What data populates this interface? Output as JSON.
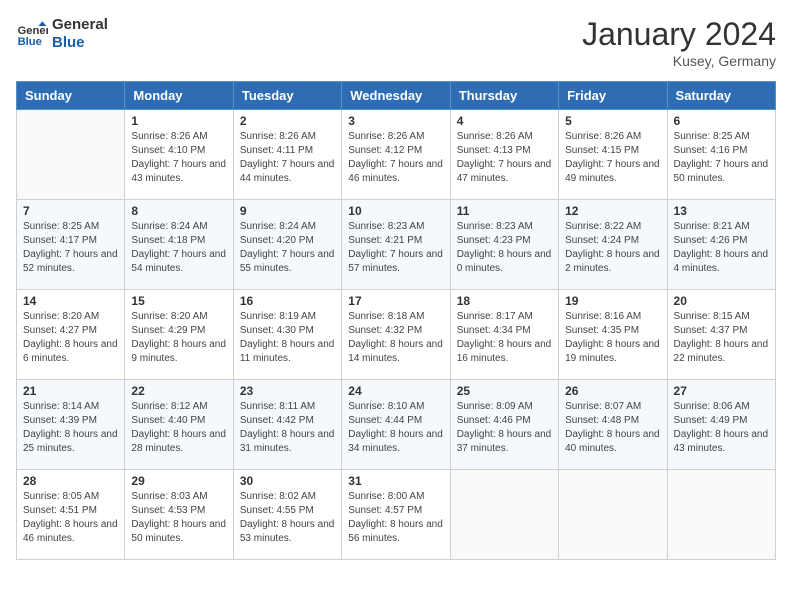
{
  "header": {
    "logo_line1": "General",
    "logo_line2": "Blue",
    "month_title": "January 2024",
    "location": "Kusey, Germany"
  },
  "days_of_week": [
    "Sunday",
    "Monday",
    "Tuesday",
    "Wednesday",
    "Thursday",
    "Friday",
    "Saturday"
  ],
  "weeks": [
    [
      {
        "day": "",
        "sunrise": "",
        "sunset": "",
        "daylight": ""
      },
      {
        "day": "1",
        "sunrise": "Sunrise: 8:26 AM",
        "sunset": "Sunset: 4:10 PM",
        "daylight": "Daylight: 7 hours and 43 minutes."
      },
      {
        "day": "2",
        "sunrise": "Sunrise: 8:26 AM",
        "sunset": "Sunset: 4:11 PM",
        "daylight": "Daylight: 7 hours and 44 minutes."
      },
      {
        "day": "3",
        "sunrise": "Sunrise: 8:26 AM",
        "sunset": "Sunset: 4:12 PM",
        "daylight": "Daylight: 7 hours and 46 minutes."
      },
      {
        "day": "4",
        "sunrise": "Sunrise: 8:26 AM",
        "sunset": "Sunset: 4:13 PM",
        "daylight": "Daylight: 7 hours and 47 minutes."
      },
      {
        "day": "5",
        "sunrise": "Sunrise: 8:26 AM",
        "sunset": "Sunset: 4:15 PM",
        "daylight": "Daylight: 7 hours and 49 minutes."
      },
      {
        "day": "6",
        "sunrise": "Sunrise: 8:25 AM",
        "sunset": "Sunset: 4:16 PM",
        "daylight": "Daylight: 7 hours and 50 minutes."
      }
    ],
    [
      {
        "day": "7",
        "sunrise": "Sunrise: 8:25 AM",
        "sunset": "Sunset: 4:17 PM",
        "daylight": "Daylight: 7 hours and 52 minutes."
      },
      {
        "day": "8",
        "sunrise": "Sunrise: 8:24 AM",
        "sunset": "Sunset: 4:18 PM",
        "daylight": "Daylight: 7 hours and 54 minutes."
      },
      {
        "day": "9",
        "sunrise": "Sunrise: 8:24 AM",
        "sunset": "Sunset: 4:20 PM",
        "daylight": "Daylight: 7 hours and 55 minutes."
      },
      {
        "day": "10",
        "sunrise": "Sunrise: 8:23 AM",
        "sunset": "Sunset: 4:21 PM",
        "daylight": "Daylight: 7 hours and 57 minutes."
      },
      {
        "day": "11",
        "sunrise": "Sunrise: 8:23 AM",
        "sunset": "Sunset: 4:23 PM",
        "daylight": "Daylight: 8 hours and 0 minutes."
      },
      {
        "day": "12",
        "sunrise": "Sunrise: 8:22 AM",
        "sunset": "Sunset: 4:24 PM",
        "daylight": "Daylight: 8 hours and 2 minutes."
      },
      {
        "day": "13",
        "sunrise": "Sunrise: 8:21 AM",
        "sunset": "Sunset: 4:26 PM",
        "daylight": "Daylight: 8 hours and 4 minutes."
      }
    ],
    [
      {
        "day": "14",
        "sunrise": "Sunrise: 8:20 AM",
        "sunset": "Sunset: 4:27 PM",
        "daylight": "Daylight: 8 hours and 6 minutes."
      },
      {
        "day": "15",
        "sunrise": "Sunrise: 8:20 AM",
        "sunset": "Sunset: 4:29 PM",
        "daylight": "Daylight: 8 hours and 9 minutes."
      },
      {
        "day": "16",
        "sunrise": "Sunrise: 8:19 AM",
        "sunset": "Sunset: 4:30 PM",
        "daylight": "Daylight: 8 hours and 11 minutes."
      },
      {
        "day": "17",
        "sunrise": "Sunrise: 8:18 AM",
        "sunset": "Sunset: 4:32 PM",
        "daylight": "Daylight: 8 hours and 14 minutes."
      },
      {
        "day": "18",
        "sunrise": "Sunrise: 8:17 AM",
        "sunset": "Sunset: 4:34 PM",
        "daylight": "Daylight: 8 hours and 16 minutes."
      },
      {
        "day": "19",
        "sunrise": "Sunrise: 8:16 AM",
        "sunset": "Sunset: 4:35 PM",
        "daylight": "Daylight: 8 hours and 19 minutes."
      },
      {
        "day": "20",
        "sunrise": "Sunrise: 8:15 AM",
        "sunset": "Sunset: 4:37 PM",
        "daylight": "Daylight: 8 hours and 22 minutes."
      }
    ],
    [
      {
        "day": "21",
        "sunrise": "Sunrise: 8:14 AM",
        "sunset": "Sunset: 4:39 PM",
        "daylight": "Daylight: 8 hours and 25 minutes."
      },
      {
        "day": "22",
        "sunrise": "Sunrise: 8:12 AM",
        "sunset": "Sunset: 4:40 PM",
        "daylight": "Daylight: 8 hours and 28 minutes."
      },
      {
        "day": "23",
        "sunrise": "Sunrise: 8:11 AM",
        "sunset": "Sunset: 4:42 PM",
        "daylight": "Daylight: 8 hours and 31 minutes."
      },
      {
        "day": "24",
        "sunrise": "Sunrise: 8:10 AM",
        "sunset": "Sunset: 4:44 PM",
        "daylight": "Daylight: 8 hours and 34 minutes."
      },
      {
        "day": "25",
        "sunrise": "Sunrise: 8:09 AM",
        "sunset": "Sunset: 4:46 PM",
        "daylight": "Daylight: 8 hours and 37 minutes."
      },
      {
        "day": "26",
        "sunrise": "Sunrise: 8:07 AM",
        "sunset": "Sunset: 4:48 PM",
        "daylight": "Daylight: 8 hours and 40 minutes."
      },
      {
        "day": "27",
        "sunrise": "Sunrise: 8:06 AM",
        "sunset": "Sunset: 4:49 PM",
        "daylight": "Daylight: 8 hours and 43 minutes."
      }
    ],
    [
      {
        "day": "28",
        "sunrise": "Sunrise: 8:05 AM",
        "sunset": "Sunset: 4:51 PM",
        "daylight": "Daylight: 8 hours and 46 minutes."
      },
      {
        "day": "29",
        "sunrise": "Sunrise: 8:03 AM",
        "sunset": "Sunset: 4:53 PM",
        "daylight": "Daylight: 8 hours and 50 minutes."
      },
      {
        "day": "30",
        "sunrise": "Sunrise: 8:02 AM",
        "sunset": "Sunset: 4:55 PM",
        "daylight": "Daylight: 8 hours and 53 minutes."
      },
      {
        "day": "31",
        "sunrise": "Sunrise: 8:00 AM",
        "sunset": "Sunset: 4:57 PM",
        "daylight": "Daylight: 8 hours and 56 minutes."
      },
      {
        "day": "",
        "sunrise": "",
        "sunset": "",
        "daylight": ""
      },
      {
        "day": "",
        "sunrise": "",
        "sunset": "",
        "daylight": ""
      },
      {
        "day": "",
        "sunrise": "",
        "sunset": "",
        "daylight": ""
      }
    ]
  ]
}
